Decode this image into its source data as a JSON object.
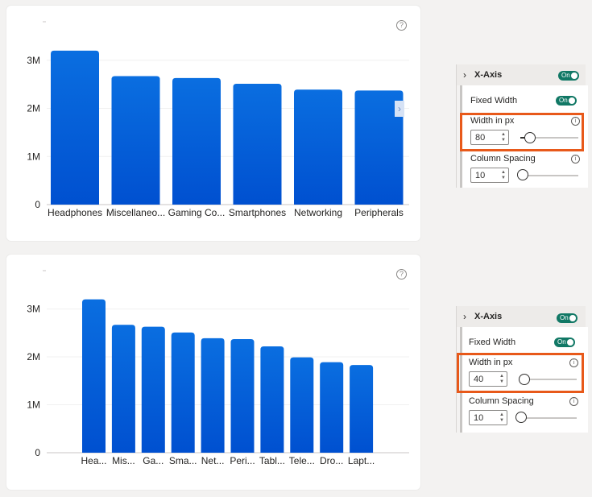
{
  "charts": [
    {
      "help_glyph": "?",
      "scroll_glyph": "›",
      "y_ticks": [
        "0",
        "1M",
        "2M",
        "3M"
      ]
    },
    {
      "help_glyph": "?",
      "y_ticks": [
        "0",
        "1M",
        "2M",
        "3M"
      ]
    }
  ],
  "chart_data": [
    {
      "type": "bar",
      "categories": [
        "Headphones",
        "Miscellaneo...",
        "Gaming Co...",
        "Smartphones",
        "Networking",
        "Peripherals"
      ],
      "values": [
        3200000,
        2670000,
        2630000,
        2510000,
        2390000,
        2370000
      ],
      "title": "",
      "xlabel": "",
      "ylabel": "",
      "ylim": [
        0,
        3800000
      ],
      "bar_color_top": "#0a6ee0",
      "bar_color_bottom": "#0050d0",
      "grid": true
    },
    {
      "type": "bar",
      "categories": [
        "Hea...",
        "Mis...",
        "Ga...",
        "Sma...",
        "Net...",
        "Peri...",
        "Tabl...",
        "Tele...",
        "Dro...",
        "Lapt..."
      ],
      "values": [
        3200000,
        2670000,
        2630000,
        2510000,
        2390000,
        2370000,
        2220000,
        1990000,
        1890000,
        1830000
      ],
      "title": "",
      "xlabel": "",
      "ylabel": "",
      "ylim": [
        0,
        3800000
      ],
      "bar_color_top": "#0a6ee0",
      "bar_color_bottom": "#0050d0",
      "grid": true
    }
  ],
  "panes": [
    {
      "title": "X-Axis",
      "chevron": "›",
      "header_toggle": "On",
      "fixed_width_label": "Fixed Width",
      "fixed_width_toggle": "On",
      "width_label": "Width in px",
      "width_value": "80",
      "width_slider_level": 0.12,
      "spacing_label": "Column Spacing",
      "spacing_value": "10",
      "spacing_slider_level": 0.0,
      "info_glyph": "i",
      "spin_up": "▲",
      "spin_down": "▼"
    },
    {
      "title": "X-Axis",
      "chevron": "›",
      "header_toggle": "On",
      "fixed_width_label": "Fixed Width",
      "fixed_width_toggle": "On",
      "width_label": "Width in px",
      "width_value": "40",
      "width_slider_level": 0.05,
      "spacing_label": "Column Spacing",
      "spacing_value": "10",
      "spacing_slider_level": 0.0,
      "info_glyph": "i",
      "spin_up": "▲",
      "spin_down": "▼"
    }
  ],
  "colors": {
    "accent_toggle": "#117865",
    "highlight": "#e8591a",
    "bar": "#0a6ee0"
  }
}
